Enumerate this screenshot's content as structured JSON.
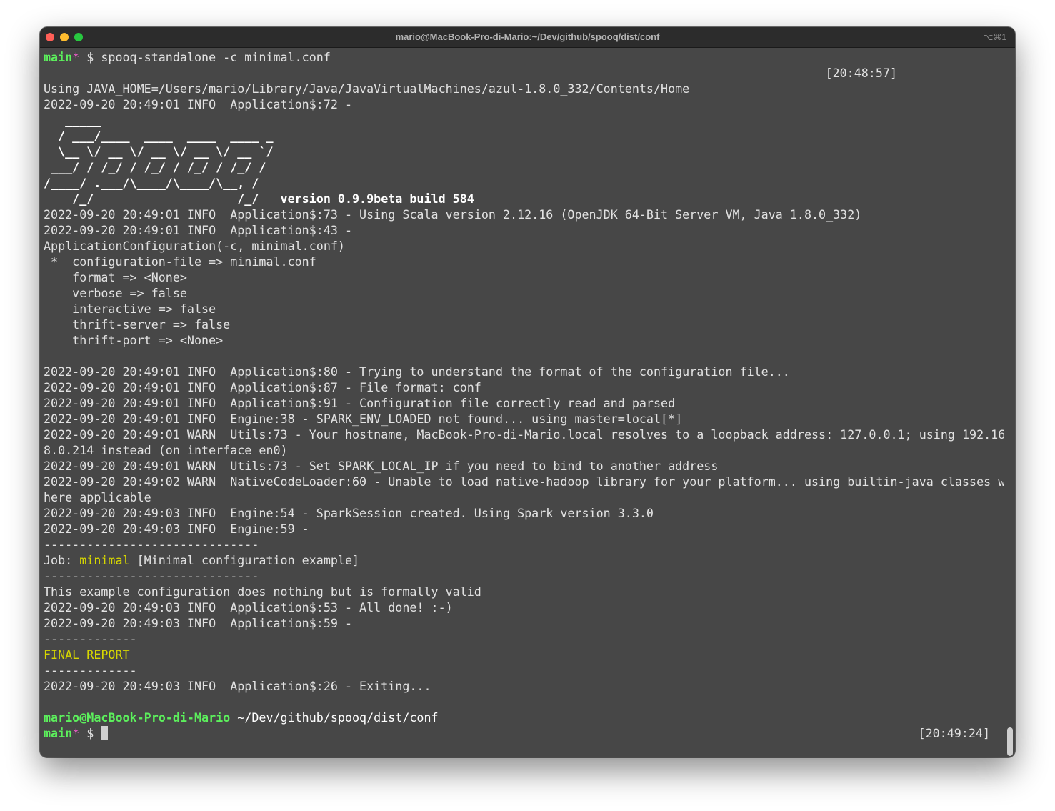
{
  "window": {
    "title": "mario@MacBook-Pro-di-Mario:~/Dev/github/spooq/dist/conf",
    "shortcut": "⌥⌘1"
  },
  "prompt1": {
    "branch": "main",
    "dirty": "*",
    "symbol": " $ ",
    "command": "spooq-standalone -c minimal.conf",
    "time": "[20:48:57]"
  },
  "output_before_banner": [
    "Using JAVA_HOME=/Users/mario/Library/Java/JavaVirtualMachines/azul-1.8.0_332/Contents/Home",
    "2022-09-20 20:49:01 INFO  Application$:72 -"
  ],
  "banner": [
    "   _____",
    "  / ___/____  ____  ____  ____ _",
    "  \\__ \\/ __ \\/ __ \\/ __ \\/ __ `/",
    " ___/ / /_/ / /_/ / /_/ / /_/ /",
    "/____/ .___/\\____/\\____/\\__, /",
    "    /_/                    /_/   version 0.9.9beta build 584"
  ],
  "output_main": [
    "2022-09-20 20:49:01 INFO  Application$:73 - Using Scala version 2.12.16 (OpenJDK 64-Bit Server VM, Java 1.8.0_332)",
    "2022-09-20 20:49:01 INFO  Application$:43 -",
    "ApplicationConfiguration(-c, minimal.conf)",
    " *  configuration-file => minimal.conf",
    "    format => <None>",
    "    verbose => false",
    "    interactive => false",
    "    thrift-server => false",
    "    thrift-port => <None>",
    "",
    "2022-09-20 20:49:01 INFO  Application$:80 - Trying to understand the format of the configuration file...",
    "2022-09-20 20:49:01 INFO  Application$:87 - File format: conf",
    "2022-09-20 20:49:01 INFO  Application$:91 - Configuration file correctly read and parsed",
    "2022-09-20 20:49:01 INFO  Engine:38 - SPARK_ENV_LOADED not found... using master=local[*]",
    "2022-09-20 20:49:01 WARN  Utils:73 - Your hostname, MacBook-Pro-di-Mario.local resolves to a loopback address: 127.0.0.1; using 192.16",
    "8.0.214 instead (on interface en0)",
    "2022-09-20 20:49:01 WARN  Utils:73 - Set SPARK_LOCAL_IP if you need to bind to another address",
    "2022-09-20 20:49:02 WARN  NativeCodeLoader:60 - Unable to load native-hadoop library for your platform... using builtin-java classes w",
    "here applicable",
    "2022-09-20 20:49:03 INFO  Engine:54 - SparkSession created. Using Spark version 3.3.0",
    "2022-09-20 20:49:03 INFO  Engine:59 -",
    "------------------------------"
  ],
  "job": {
    "prefix": "Job: ",
    "name": "minimal",
    "description": " [Minimal configuration example]"
  },
  "output_after_job": [
    "------------------------------",
    "This example configuration does nothing but is formally valid",
    "2022-09-20 20:49:03 INFO  Application$:53 - All done! :-)",
    "2022-09-20 20:49:03 INFO  Application$:59 -",
    "-------------"
  ],
  "final_report": "FINAL REPORT",
  "output_end": [
    "-------------",
    "2022-09-20 20:49:03 INFO  Application$:26 - Exiting...",
    ""
  ],
  "prompt2": {
    "user_host": "mario@MacBook-Pro-di-Mario",
    "path": " ~/Dev/github/spooq/dist/conf",
    "branch": "main",
    "dirty": "*",
    "symbol": " $ ",
    "time": "[20:49:24]"
  }
}
